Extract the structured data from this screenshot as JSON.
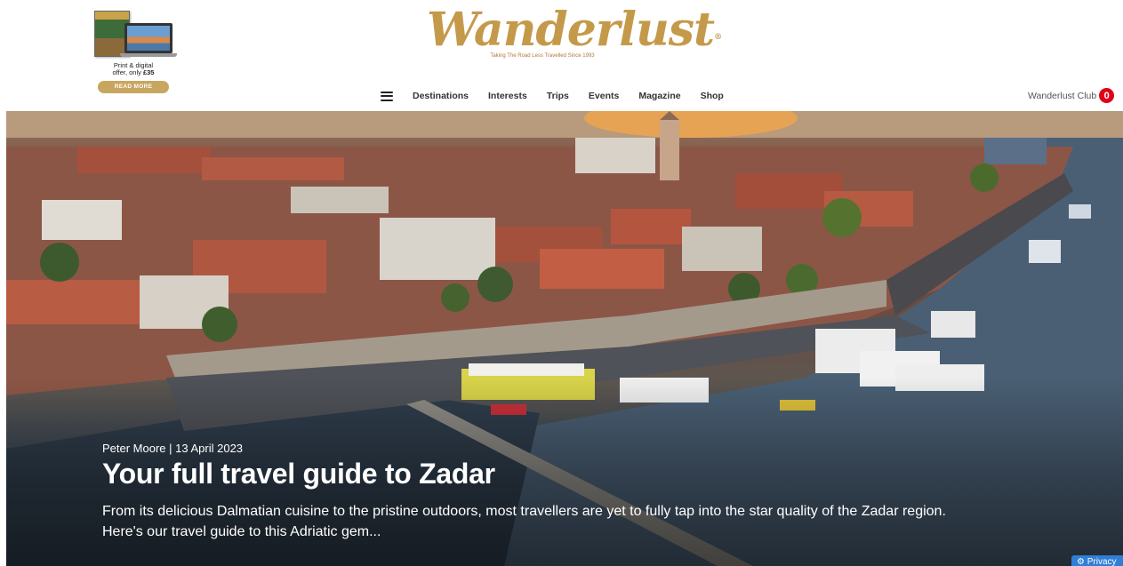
{
  "promo": {
    "line1": "Print & digital",
    "line2": "offer, only ",
    "price": "£35",
    "button": "READ MORE"
  },
  "brand": {
    "logo": "Wanderlust",
    "reg": "®",
    "tagline": "Taking The Road Less Travelled Since 1993"
  },
  "nav": {
    "menu_icon": "hamburger-icon",
    "items": [
      {
        "label": "Destinations"
      },
      {
        "label": "Interests"
      },
      {
        "label": "Trips"
      },
      {
        "label": "Events"
      },
      {
        "label": "Magazine"
      },
      {
        "label": "Shop"
      }
    ]
  },
  "club": {
    "label": "Wanderlust Club",
    "count": "0"
  },
  "hero": {
    "image": "aerial view of Zadar old town peninsula at sunset",
    "meta": "Peter Moore | 13 April 2023",
    "title": "Your full travel guide to Zadar",
    "description": "From its delicious Dalmatian cuisine to the pristine outdoors, most travellers are yet to fully tap into the star quality of the Zadar region. Here's our travel guide to this Adriatic gem..."
  },
  "privacy": {
    "icon": "gear-icon",
    "label": "Privacy"
  },
  "colors": {
    "brand_gold": "#c49a4a",
    "badge_red": "#e0001a",
    "privacy_blue": "#2f7fd6"
  }
}
